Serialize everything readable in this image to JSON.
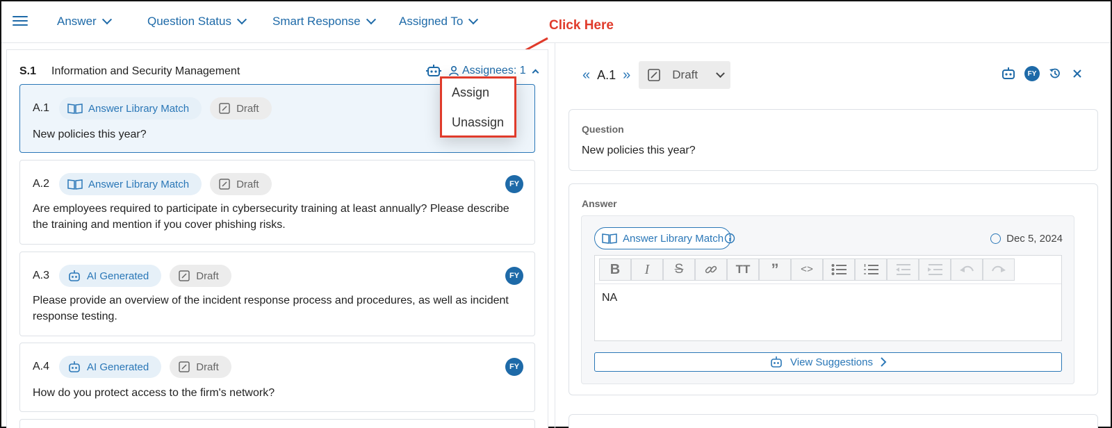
{
  "topbar": {
    "filters": [
      {
        "label": "Answer"
      },
      {
        "label": "Question Status"
      },
      {
        "label": "Smart Response"
      },
      {
        "label": "Assigned To"
      }
    ]
  },
  "annotation": {
    "callout": "Click Here"
  },
  "section": {
    "code": "S.1",
    "title": "Information and Security Management",
    "assignees_label": "Assignees: 1"
  },
  "dropdown": {
    "options": [
      "Assign",
      "Unassign"
    ]
  },
  "questions": [
    {
      "id": "A.1",
      "source": "Answer Library Match",
      "status": "Draft",
      "text": "New policies this year?",
      "avatar": ""
    },
    {
      "id": "A.2",
      "source": "Answer Library Match",
      "status": "Draft",
      "text": "Are employees required to participate in cybersecurity training at least annually? Please describe the training and mention if you cover phishing risks.",
      "avatar": "FY"
    },
    {
      "id": "A.3",
      "source": "AI Generated",
      "status": "Draft",
      "text": "Please provide an overview of the incident response process and procedures, as well as incident response testing.",
      "avatar": "FY"
    },
    {
      "id": "A.4",
      "source": "AI Generated",
      "status": "Draft",
      "text": "How do you protect access to the firm's network?",
      "avatar": "FY"
    }
  ],
  "detail": {
    "qid": "A.1",
    "status": "Draft",
    "avatar": "FY",
    "question_label": "Question",
    "question_text": "New policies this year?",
    "answer_label": "Answer",
    "answer_source": "Answer Library Match",
    "date": "Dec 5, 2024",
    "answer_text": "NA",
    "view_suggestions": "View Suggestions"
  },
  "colors": {
    "accent": "#1e6aa8",
    "annotation": "#e03b2b",
    "selected_bg": "#eef5fb"
  }
}
